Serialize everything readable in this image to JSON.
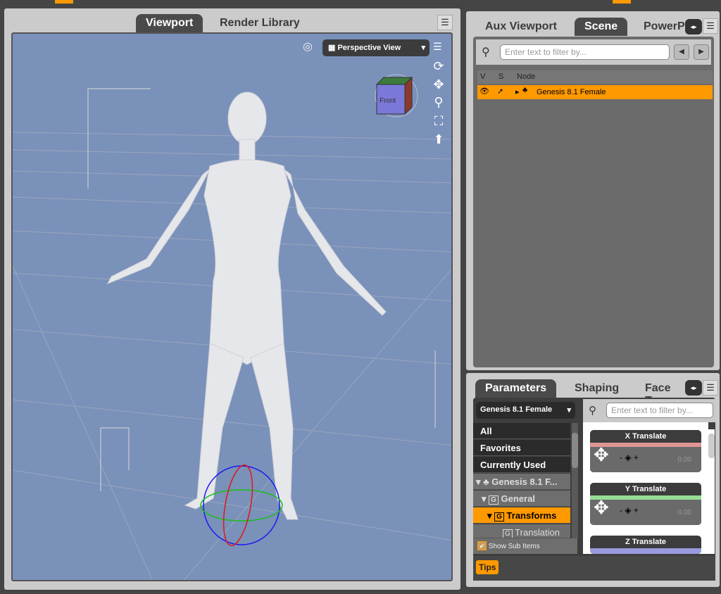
{
  "left_panel": {
    "tabs": [
      {
        "label": "Viewport",
        "active": true
      },
      {
        "label": "Render Library",
        "active": false
      }
    ],
    "viewport": {
      "camera": "Perspective View",
      "cube_label": "Front",
      "background": "#7a91ba",
      "tools": [
        "orbit-icon",
        "pan-icon",
        "zoom-icon",
        "frame-icon",
        "reset-icon"
      ]
    }
  },
  "scene_panel": {
    "tabs": [
      {
        "label": "Aux Viewport",
        "active": false
      },
      {
        "label": "Scene",
        "active": true
      },
      {
        "label": "PowerP",
        "active": false
      }
    ],
    "filter_placeholder": "Enter text to filter by...",
    "columns": [
      "V",
      "S",
      "Node"
    ],
    "rows": [
      {
        "node": "Genesis 8.1 Female",
        "selected": true
      }
    ]
  },
  "parameters_panel": {
    "tabs": [
      {
        "label": "Parameters",
        "active": true
      },
      {
        "label": "Shaping",
        "active": false
      },
      {
        "label": "Face Tr",
        "active": false
      }
    ],
    "figure_select": "Genesis 8.1 Female",
    "filter_placeholder": "Enter text to filter by...",
    "categories": [
      "All",
      "Favorites",
      "Currently Used"
    ],
    "tree": [
      "Genesis 8.1 F...",
      "General",
      "Transforms",
      "Translation"
    ],
    "show_sub_items": "Show Sub Items",
    "show_sub_items_checked": true,
    "params": [
      {
        "label": "X Translate",
        "value": "0.00",
        "color": "#e09595"
      },
      {
        "label": "Y Translate",
        "value": "0.00",
        "color": "#95dd95"
      },
      {
        "label": "Z Translate",
        "value": "",
        "color": "#9a9ae0"
      }
    ],
    "tips": "Tips"
  },
  "accent": "#ff9900"
}
